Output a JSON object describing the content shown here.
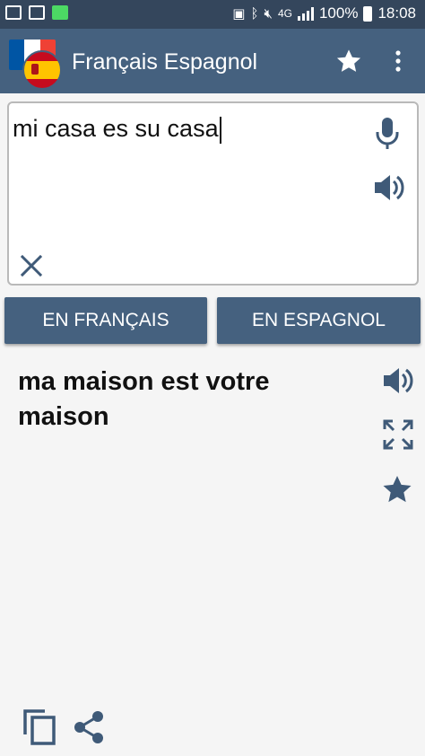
{
  "status_bar": {
    "network": "4G",
    "battery": "100%",
    "time": "18:08"
  },
  "app_bar": {
    "title": "Français Espagnol",
    "icons": [
      "flag-france",
      "flag-spain",
      "star-icon",
      "more-vert-icon"
    ]
  },
  "input": {
    "text": "mi casa es su casa",
    "icons": [
      "microphone-icon",
      "speaker-icon",
      "clear-icon"
    ]
  },
  "buttons": {
    "to_french": "EN FRANÇAIS",
    "to_spanish": "EN ESPAGNOL"
  },
  "result": {
    "text": "ma maison est votre maison",
    "icons": [
      "speaker-icon",
      "fullscreen-icon",
      "star-icon"
    ]
  },
  "bottom_actions": {
    "icons": [
      "copy-icon",
      "share-icon"
    ]
  },
  "colors": {
    "status_bar": "#34465c",
    "primary": "#45617f",
    "icon": "#3f5a78",
    "background": "#f5f5f5"
  }
}
